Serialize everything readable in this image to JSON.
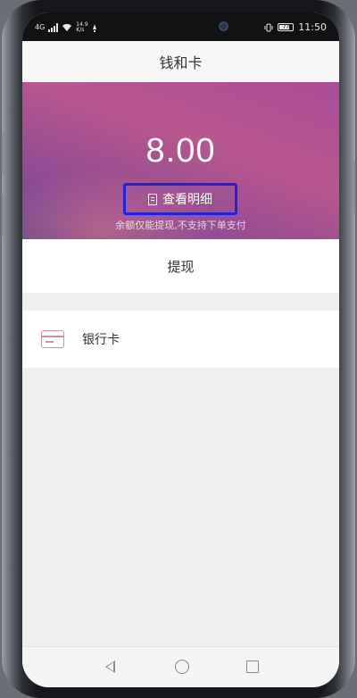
{
  "status_bar": {
    "network": "4G",
    "speed_value": "14.9",
    "speed_unit": "K/s",
    "battery": "77",
    "time": "11:50"
  },
  "header": {
    "title": "钱和卡"
  },
  "hero": {
    "balance": "8.00",
    "detail_label": "查看明细",
    "hint": "余额仅能提现,不支持下单支付",
    "colors": {
      "gradient_top": "#a94d97",
      "gradient_bottom": "#6a4a8e",
      "highlight_border": "#1a24e6"
    }
  },
  "withdraw": {
    "label": "提现"
  },
  "bank_card": {
    "label": "银行卡",
    "icon": "card-icon"
  },
  "nav": {
    "icons": [
      "back-triangle-icon",
      "home-circle-icon",
      "recent-square-icon"
    ]
  }
}
